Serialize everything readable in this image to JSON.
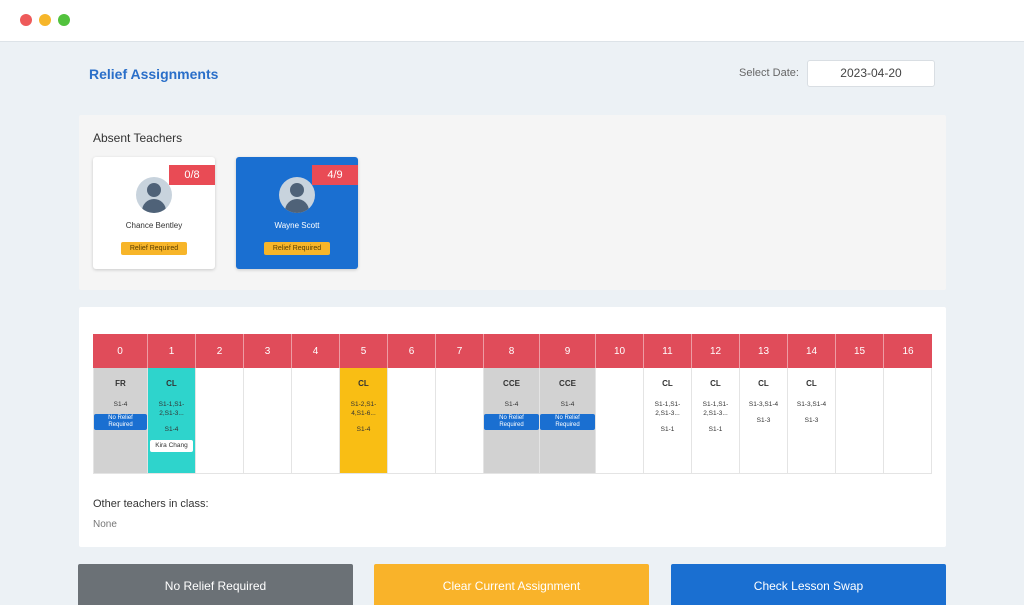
{
  "header": {
    "title": "Relief Assignments",
    "date_label": "Select Date:",
    "date_value": "2023-04-20"
  },
  "absent": {
    "title": "Absent Teachers",
    "teachers": [
      {
        "name": "Chance Bentley",
        "count": "0/8",
        "tag": "Relief Required"
      },
      {
        "name": "Wayne Scott",
        "count": "4/9",
        "tag": "Relief Required"
      }
    ]
  },
  "timetable": {
    "periods": [
      "0",
      "1",
      "2",
      "3",
      "4",
      "5",
      "6",
      "7",
      "8",
      "9",
      "10",
      "11",
      "12",
      "13",
      "14",
      "15",
      "16"
    ],
    "slots": [
      {
        "subject": "FR",
        "classes": "S1-4",
        "classes2": "",
        "badge": "No Relief Required",
        "teacher": ""
      },
      {
        "subject": "CL",
        "classes": "S1-1,S1-2,S1-3...",
        "classes2": "S1-4",
        "badge": "",
        "teacher": "Kira Chang"
      },
      {
        "subject": "",
        "classes": "",
        "classes2": "",
        "badge": "",
        "teacher": ""
      },
      {
        "subject": "",
        "classes": "",
        "classes2": "",
        "badge": "",
        "teacher": ""
      },
      {
        "subject": "",
        "classes": "",
        "classes2": "",
        "badge": "",
        "teacher": ""
      },
      {
        "subject": "CL",
        "classes": "S1-2,S1-4,S1-6...",
        "classes2": "S1-4",
        "badge": "",
        "teacher": ""
      },
      {
        "subject": "",
        "classes": "",
        "classes2": "",
        "badge": "",
        "teacher": ""
      },
      {
        "subject": "",
        "classes": "",
        "classes2": "",
        "badge": "",
        "teacher": ""
      },
      {
        "subject": "CCE",
        "classes": "S1-4",
        "classes2": "",
        "badge": "No Relief Required",
        "teacher": ""
      },
      {
        "subject": "CCE",
        "classes": "S1-4",
        "classes2": "",
        "badge": "No Relief Required",
        "teacher": ""
      },
      {
        "subject": "",
        "classes": "",
        "classes2": "",
        "badge": "",
        "teacher": ""
      },
      {
        "subject": "CL",
        "classes": "S1-1,S1-2,S1-3...",
        "classes2": "S1-1",
        "badge": "",
        "teacher": ""
      },
      {
        "subject": "CL",
        "classes": "S1-1,S1-2,S1-3...",
        "classes2": "S1-1",
        "badge": "",
        "teacher": ""
      },
      {
        "subject": "CL",
        "classes": "S1-3,S1-4",
        "classes2": "S1-3",
        "badge": "",
        "teacher": ""
      },
      {
        "subject": "CL",
        "classes": "S1-3,S1-4",
        "classes2": "S1-3",
        "badge": "",
        "teacher": ""
      },
      {
        "subject": "",
        "classes": "",
        "classes2": "",
        "badge": "",
        "teacher": ""
      },
      {
        "subject": "",
        "classes": "",
        "classes2": "",
        "badge": "",
        "teacher": ""
      }
    ],
    "other_label": "Other teachers in class:",
    "other_value": "None"
  },
  "actions": {
    "no_relief": "No Relief Required",
    "clear": "Clear Current Assignment",
    "swap": "Check Lesson Swap"
  },
  "colors": {
    "accent": "#1a6fd1",
    "header": "#e04c5a",
    "relief_tag": "#f7b529"
  }
}
